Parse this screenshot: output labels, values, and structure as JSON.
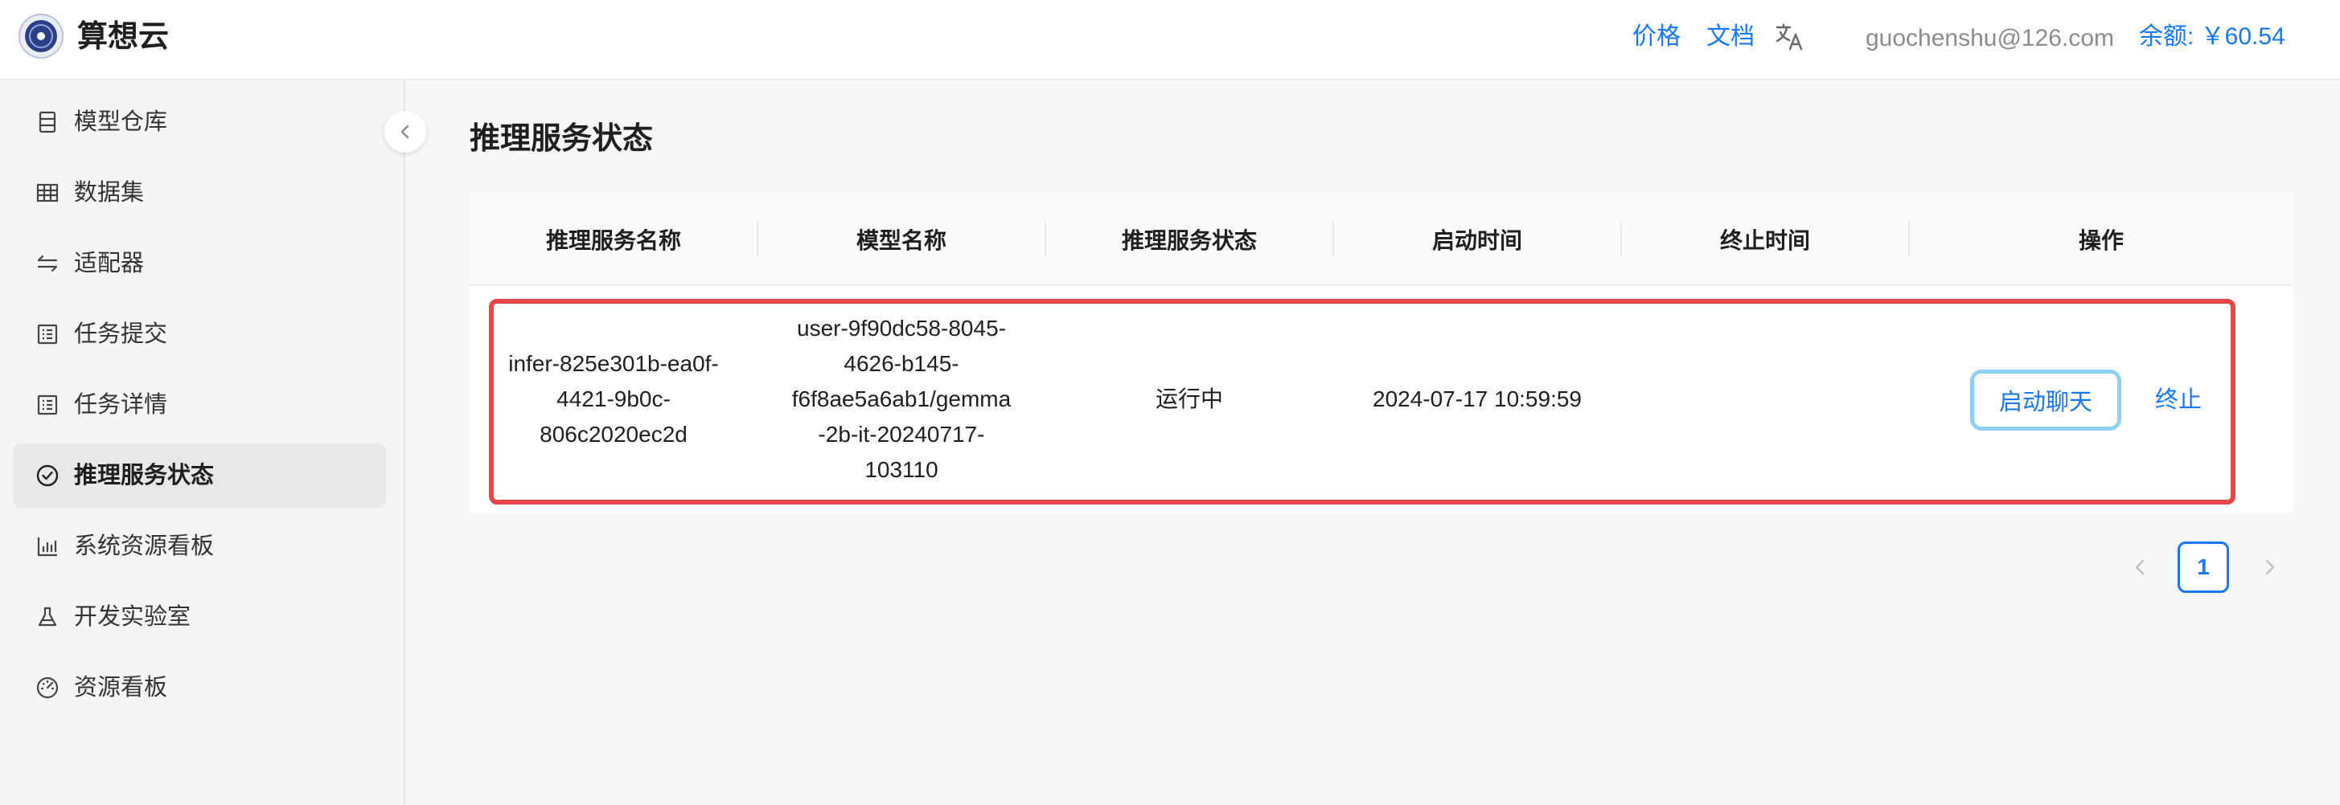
{
  "header": {
    "brand": "算想云",
    "links": {
      "price": "价格",
      "docs": "文档"
    },
    "email": "guochenshu@126.com",
    "balance": "余额: ￥60.54"
  },
  "sidebar": {
    "items": [
      {
        "label": "模型仓库",
        "icon": "model-repo-icon"
      },
      {
        "label": "数据集",
        "icon": "table-grid-icon"
      },
      {
        "label": "适配器",
        "icon": "swap-arrows-icon"
      },
      {
        "label": "任务提交",
        "icon": "list-doc-icon"
      },
      {
        "label": "任务详情",
        "icon": "list-doc-icon"
      },
      {
        "label": "推理服务状态",
        "icon": "check-circle-icon",
        "active": true
      },
      {
        "label": "系统资源看板",
        "icon": "bar-chart-icon"
      },
      {
        "label": "开发实验室",
        "icon": "flask-icon"
      },
      {
        "label": "资源看板",
        "icon": "dashboard-icon"
      }
    ]
  },
  "page": {
    "title": "推理服务状态"
  },
  "table": {
    "headers": [
      "推理服务名称",
      "模型名称",
      "推理服务状态",
      "启动时间",
      "终止时间",
      "操作"
    ],
    "rows": [
      {
        "service_name": "infer-825e301b-ea0f-\n4421-9b0c-\n806c2020ec2d",
        "model_name": "user-9f90dc58-8045-\n4626-b145-\nf6f8ae5a6ab1/gemma\n-2b-it-20240717-\n103110",
        "status": "运行中",
        "start_time": "2024-07-17 10:59:59",
        "end_time": "",
        "actions": {
          "chat": "启动聊天",
          "stop": "终止"
        }
      }
    ]
  },
  "pagination": {
    "current_page": "1"
  },
  "colors": {
    "accent": "#1677ff",
    "highlight": "#e8474a",
    "chat_button_border": "#8fd0f5"
  }
}
